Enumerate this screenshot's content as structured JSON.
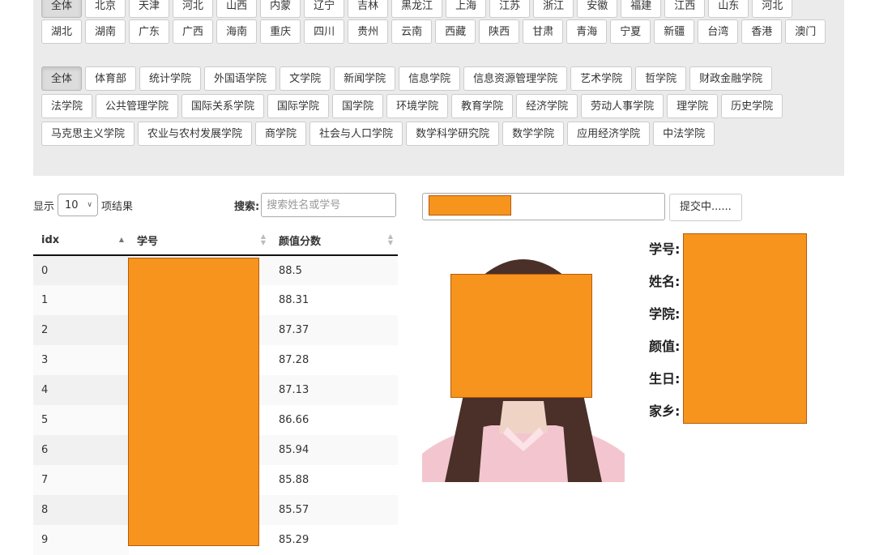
{
  "provinces_row1": [
    "全体",
    "北京",
    "天津",
    "河北",
    "山西",
    "内蒙",
    "辽宁",
    "吉林",
    "黑龙江",
    "上海",
    "江苏",
    "浙江",
    "安徽",
    "福建",
    "江西",
    "山东",
    "河北"
  ],
  "provinces_row2": [
    "湖北",
    "湖南",
    "广东",
    "广西",
    "海南",
    "重庆",
    "四川",
    "贵州",
    "云南",
    "西藏",
    "陕西",
    "甘肃",
    "青海",
    "宁夏",
    "新疆",
    "台湾",
    "香港",
    "澳门"
  ],
  "colleges_row1": [
    "全体",
    "体育部",
    "统计学院",
    "外国语学院",
    "文学院",
    "新闻学院",
    "信息学院",
    "信息资源管理学院",
    "艺术学院",
    "哲学院",
    "财政金融学院"
  ],
  "colleges_row2": [
    "法学院",
    "公共管理学院",
    "国际关系学院",
    "国际学院",
    "国学院",
    "环境学院",
    "教育学院",
    "经济学院",
    "劳动人事学院",
    "理学院",
    "历史学院"
  ],
  "colleges_row3": [
    "马克思主义学院",
    "农业与农村发展学院",
    "商学院",
    "社会与人口学院",
    "数学科学研究院",
    "数学学院",
    "应用经济学院",
    "中法学院"
  ],
  "length": {
    "prefix": "显示",
    "value": "10",
    "suffix": "项结果"
  },
  "search": {
    "label": "搜索:",
    "placeholder": "搜索姓名或学号"
  },
  "table": {
    "headers": [
      "idx",
      "学号",
      "颜值分数"
    ],
    "rows": [
      {
        "idx": "0",
        "score": "88.5"
      },
      {
        "idx": "1",
        "score": "88.31"
      },
      {
        "idx": "2",
        "score": "87.37"
      },
      {
        "idx": "3",
        "score": "87.28"
      },
      {
        "idx": "4",
        "score": "87.13"
      },
      {
        "idx": "5",
        "score": "86.66"
      },
      {
        "idx": "6",
        "score": "85.94"
      },
      {
        "idx": "7",
        "score": "85.88"
      },
      {
        "idx": "8",
        "score": "85.57"
      },
      {
        "idx": "9",
        "score": "85.29"
      }
    ]
  },
  "submit": {
    "label": "提交中......"
  },
  "info_labels": [
    "学号:",
    "姓名:",
    "学院:",
    "颜值:",
    "生日:",
    "家乡:"
  ],
  "colors": {
    "redaction": "#f7941d",
    "panel": "#ebebeb"
  }
}
